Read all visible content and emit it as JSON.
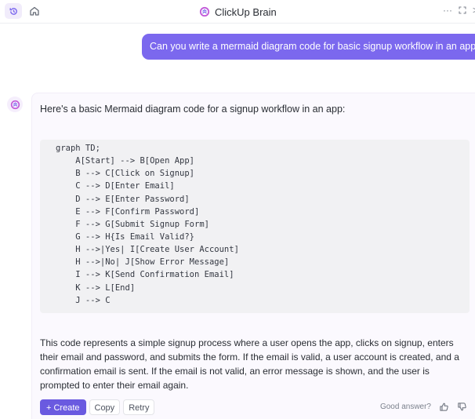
{
  "header": {
    "title": "ClickUp Brain",
    "history_icon": "history-icon",
    "home_icon": "home-icon",
    "more": "···",
    "expand_icon": "expand-icon",
    "close_partial": ">"
  },
  "user_message": "Can you write a mermaid diagram code for basic signup workflow in an app",
  "answer": {
    "intro": "Here's a basic Mermaid diagram code for a signup workflow in an app:",
    "code": [
      "graph TD;",
      "    A[Start] --> B[Open App]",
      "    B --> C[Click on Signup]",
      "    C --> D[Enter Email]",
      "    D --> E[Enter Password]",
      "    E --> F[Confirm Password]",
      "    F --> G[Submit Signup Form]",
      "    G --> H{Is Email Valid?}",
      "    H -->|Yes| I[Create User Account]",
      "    H -->|No| J[Show Error Message]",
      "    I --> K[Send Confirmation Email]",
      "    K --> L[End]",
      "    J --> C"
    ],
    "explanation": [
      "This code represents a simple signup process where a user opens the app, clicks on signup, enters",
      "their email and password, and submits the form. If the email is valid, a user account is created, and a",
      "confirmation email is sent. If the email is not valid, an error message is shown, and the user is",
      "prompted to enter their email again."
    ],
    "actions": {
      "create": "+ Create",
      "copy": "Copy",
      "retry": "Retry"
    },
    "feedback": {
      "label": "Good answer?"
    }
  },
  "colors": {
    "accent": "#7b68ee",
    "create_button": "#6a5ae0",
    "code_background": "#f1f1f3",
    "answer_background": "#fbf9fe"
  }
}
